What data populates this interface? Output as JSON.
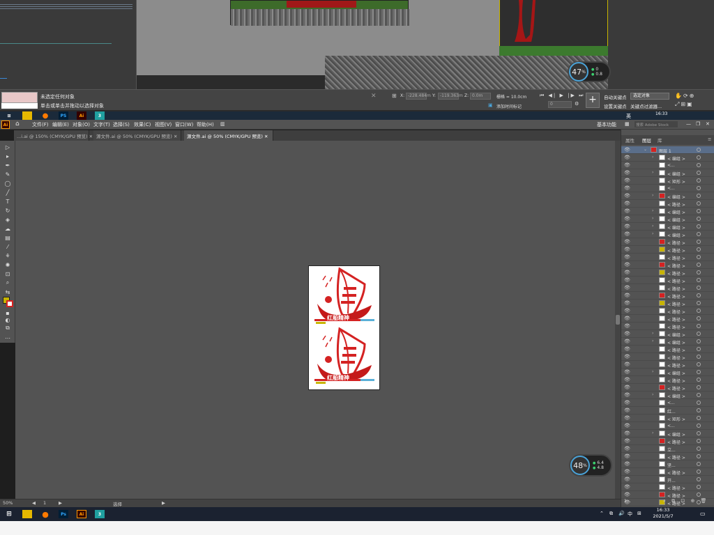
{
  "max": {
    "status_line1": "未选定任何对象",
    "status_line2": "单击或单击并拖动以选择对象",
    "coord_x_label": "X:",
    "coord_x_value": "-228.484m",
    "coord_y_label": "Y:",
    "coord_y_value": "-119.363m",
    "coord_z_label": "Z:",
    "coord_z_value": "0.0m",
    "grid_label": "栅格 = 10.0cm",
    "auto_key": "自动关键点",
    "selected_object": "选定对象",
    "set_key": "设置关键点",
    "key_filter": "关键点过滤器...",
    "add_time_tag": "添加时间标记",
    "frame_field": "0",
    "meter_top": {
      "percent": "47",
      "up": "0",
      "down": "0.8"
    },
    "clock_time": "16:33"
  },
  "taskbar_top": {
    "ime": "英",
    "time": "16:33",
    "apps": [
      "PS",
      "Ai",
      "3"
    ]
  },
  "ai": {
    "logo": "Ai",
    "menus": [
      "文件(F)",
      "编辑(E)",
      "对象(O)",
      "文字(T)",
      "选择(S)",
      "效果(C)",
      "视图(V)",
      "窗口(W)",
      "帮助(H)"
    ],
    "workspace": "基本功能",
    "search_placeholder": "搜索 Adobe Stock",
    "tabs": [
      {
        "label": "...i.ai @ 150% (CMYK/GPU 预览)"
      },
      {
        "label": "源文件.ai @ 50% (CMYK/GPU 预览)"
      },
      {
        "label": "源文件.ai @ 50% (CMYK/GPU 预览)"
      }
    ],
    "status_zoom": "50%",
    "status_page": "1",
    "status_tool": "选择",
    "artwork_title_1": "红船精神",
    "artwork_title_2": "红船精神"
  },
  "layers": {
    "tab_properties": "属性",
    "tab_layers": "图层",
    "tab_libraries": "库",
    "layer_name": "图层 1",
    "rows": [
      "< 编组 >",
      "<...",
      "< 编组 >",
      "< 矩形 >",
      "<...",
      "< 编组 >",
      "< 路径 >",
      "< 编组 >",
      "< 编组 >",
      "< 编组 >",
      "< 编组 >",
      "< 路径 >",
      "< 路径 >",
      "< 路径 >",
      "< 路径 >",
      "< 路径 >",
      "< 路径 >",
      "< 路径 >",
      "< 路径 >",
      "< 路径 >",
      "< 路径 >",
      "< 路径 >",
      "< 路径 >",
      "< 编组 >",
      "< 编组 >",
      "< 路径 >",
      "< 路径 >",
      "< 路径 >",
      "< 编组 >",
      "< 路径 >",
      "< 路径 >",
      "< 编组 >",
      "<...",
      "红...",
      "< 矩形 >",
      "<...",
      "< 编组 >",
      "< 路径 >",
      "立...",
      "< 路径 >",
      "坚...",
      "< 路径 >",
      "开...",
      "< 路径 >",
      "< 路径 >",
      "< 路径 >",
      "< 路径 >",
      "< 路径 >"
    ],
    "footer": "1..."
  },
  "meter_bottom": {
    "percent": "48",
    "up": "6.4",
    "down": "4.8"
  },
  "taskbar_bottom": {
    "time": "16:33",
    "date": "2021/5/7",
    "ime": "中",
    "apps": [
      "Ps",
      "Ai",
      "3"
    ]
  },
  "colors": {
    "accent_red": "#d42222",
    "ai_orange": "#ff9a00",
    "viewport_border": "#c8b400",
    "meter_ring": "#4aa3d8"
  }
}
